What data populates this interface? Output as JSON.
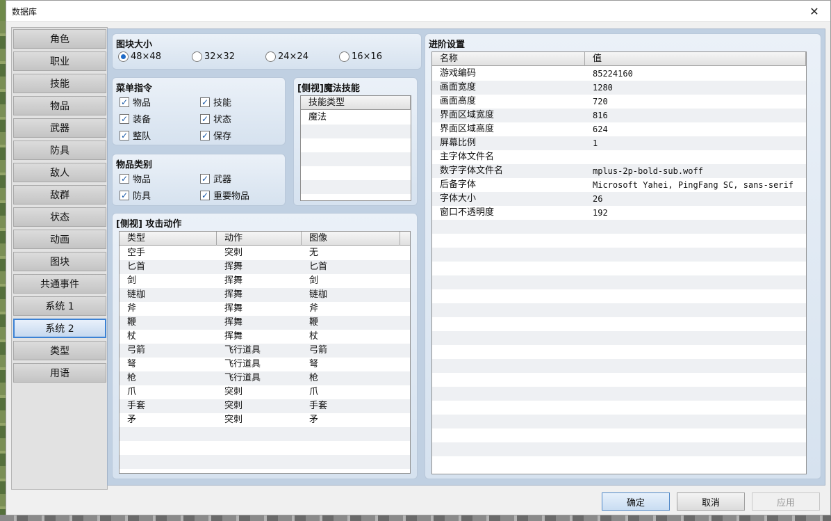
{
  "window": {
    "title": "数据库",
    "close_glyph": "✕"
  },
  "sidebar": {
    "items": [
      {
        "label": "角色"
      },
      {
        "label": "职业"
      },
      {
        "label": "技能"
      },
      {
        "label": "物品"
      },
      {
        "label": "武器"
      },
      {
        "label": "防具"
      },
      {
        "label": "敌人"
      },
      {
        "label": "敌群"
      },
      {
        "label": "状态"
      },
      {
        "label": "动画"
      },
      {
        "label": "图块"
      },
      {
        "label": "共通事件"
      },
      {
        "label": "系统 1"
      },
      {
        "label": "系统 2"
      },
      {
        "label": "类型"
      },
      {
        "label": "用语"
      }
    ],
    "selected": "系统 2"
  },
  "tile_size": {
    "title": "图块大小",
    "options": [
      {
        "label": "48×48",
        "checked": true
      },
      {
        "label": "32×32",
        "checked": false
      },
      {
        "label": "24×24",
        "checked": false
      },
      {
        "label": "16×16",
        "checked": false
      }
    ]
  },
  "menu_commands": {
    "title": "菜单指令",
    "items": [
      {
        "label": "物品",
        "checked": true
      },
      {
        "label": "技能",
        "checked": true
      },
      {
        "label": "装备",
        "checked": true
      },
      {
        "label": "状态",
        "checked": true
      },
      {
        "label": "整队",
        "checked": true
      },
      {
        "label": "保存",
        "checked": true
      }
    ]
  },
  "item_categories": {
    "title": "物品类别",
    "items": [
      {
        "label": "物品",
        "checked": true
      },
      {
        "label": "武器",
        "checked": true
      },
      {
        "label": "防具",
        "checked": true
      },
      {
        "label": "重要物品",
        "checked": true
      }
    ]
  },
  "magic_skills": {
    "title": "[侧视]魔法技能",
    "header": "技能类型",
    "rows": [
      "魔法"
    ]
  },
  "attack_motions": {
    "title": "[侧视] 攻击动作",
    "headers": [
      "类型",
      "动作",
      "图像"
    ],
    "rows": [
      [
        "空手",
        "突刺",
        "无"
      ],
      [
        "匕首",
        "挥舞",
        "匕首"
      ],
      [
        "剑",
        "挥舞",
        "剑"
      ],
      [
        "链枷",
        "挥舞",
        "链枷"
      ],
      [
        "斧",
        "挥舞",
        "斧"
      ],
      [
        "鞭",
        "挥舞",
        "鞭"
      ],
      [
        "杖",
        "挥舞",
        "杖"
      ],
      [
        "弓箭",
        "飞行道具",
        "弓箭"
      ],
      [
        "弩",
        "飞行道具",
        "弩"
      ],
      [
        "枪",
        "飞行道具",
        "枪"
      ],
      [
        "爪",
        "突刺",
        "爪"
      ],
      [
        "手套",
        "突刺",
        "手套"
      ],
      [
        "矛",
        "突刺",
        "矛"
      ]
    ]
  },
  "advanced": {
    "title": "进阶设置",
    "headers": [
      "名称",
      "值"
    ],
    "rows": [
      [
        "游戏编码",
        "85224160"
      ],
      [
        "画面宽度",
        "1280"
      ],
      [
        "画面高度",
        "720"
      ],
      [
        "界面区域宽度",
        "816"
      ],
      [
        "界面区域高度",
        "624"
      ],
      [
        "屏幕比例",
        "1"
      ],
      [
        "主字体文件名",
        ""
      ],
      [
        "数字字体文件名",
        "mplus-2p-bold-sub.woff"
      ],
      [
        "后备字体",
        "Microsoft Yahei, PingFang SC, sans-serif"
      ],
      [
        "字体大小",
        "26"
      ],
      [
        "窗口不透明度",
        "192"
      ]
    ]
  },
  "buttons": {
    "ok": "确定",
    "cancel": "取消",
    "apply": "应用"
  }
}
